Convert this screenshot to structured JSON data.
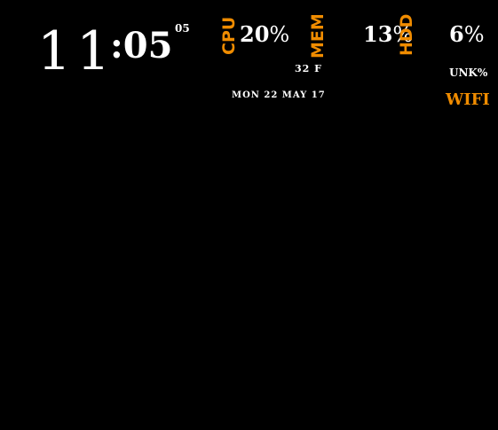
{
  "clock": {
    "hour": "11",
    "minute": ":05",
    "second": "05"
  },
  "date": "MON 22 MAY 17",
  "temperature": "32 F",
  "stats": {
    "cpu": {
      "label": "CPU",
      "value": "20",
      "unit": "%"
    },
    "mem": {
      "label": "MEM",
      "value": "13",
      "unit": "%"
    },
    "hdd": {
      "label": "HDD",
      "value": "6",
      "unit": "%"
    }
  },
  "network": {
    "value": "UNK%",
    "label": "WIFI"
  },
  "colors": {
    "background": "#000000",
    "text": "#ffffff",
    "accent": "#f08c00"
  }
}
